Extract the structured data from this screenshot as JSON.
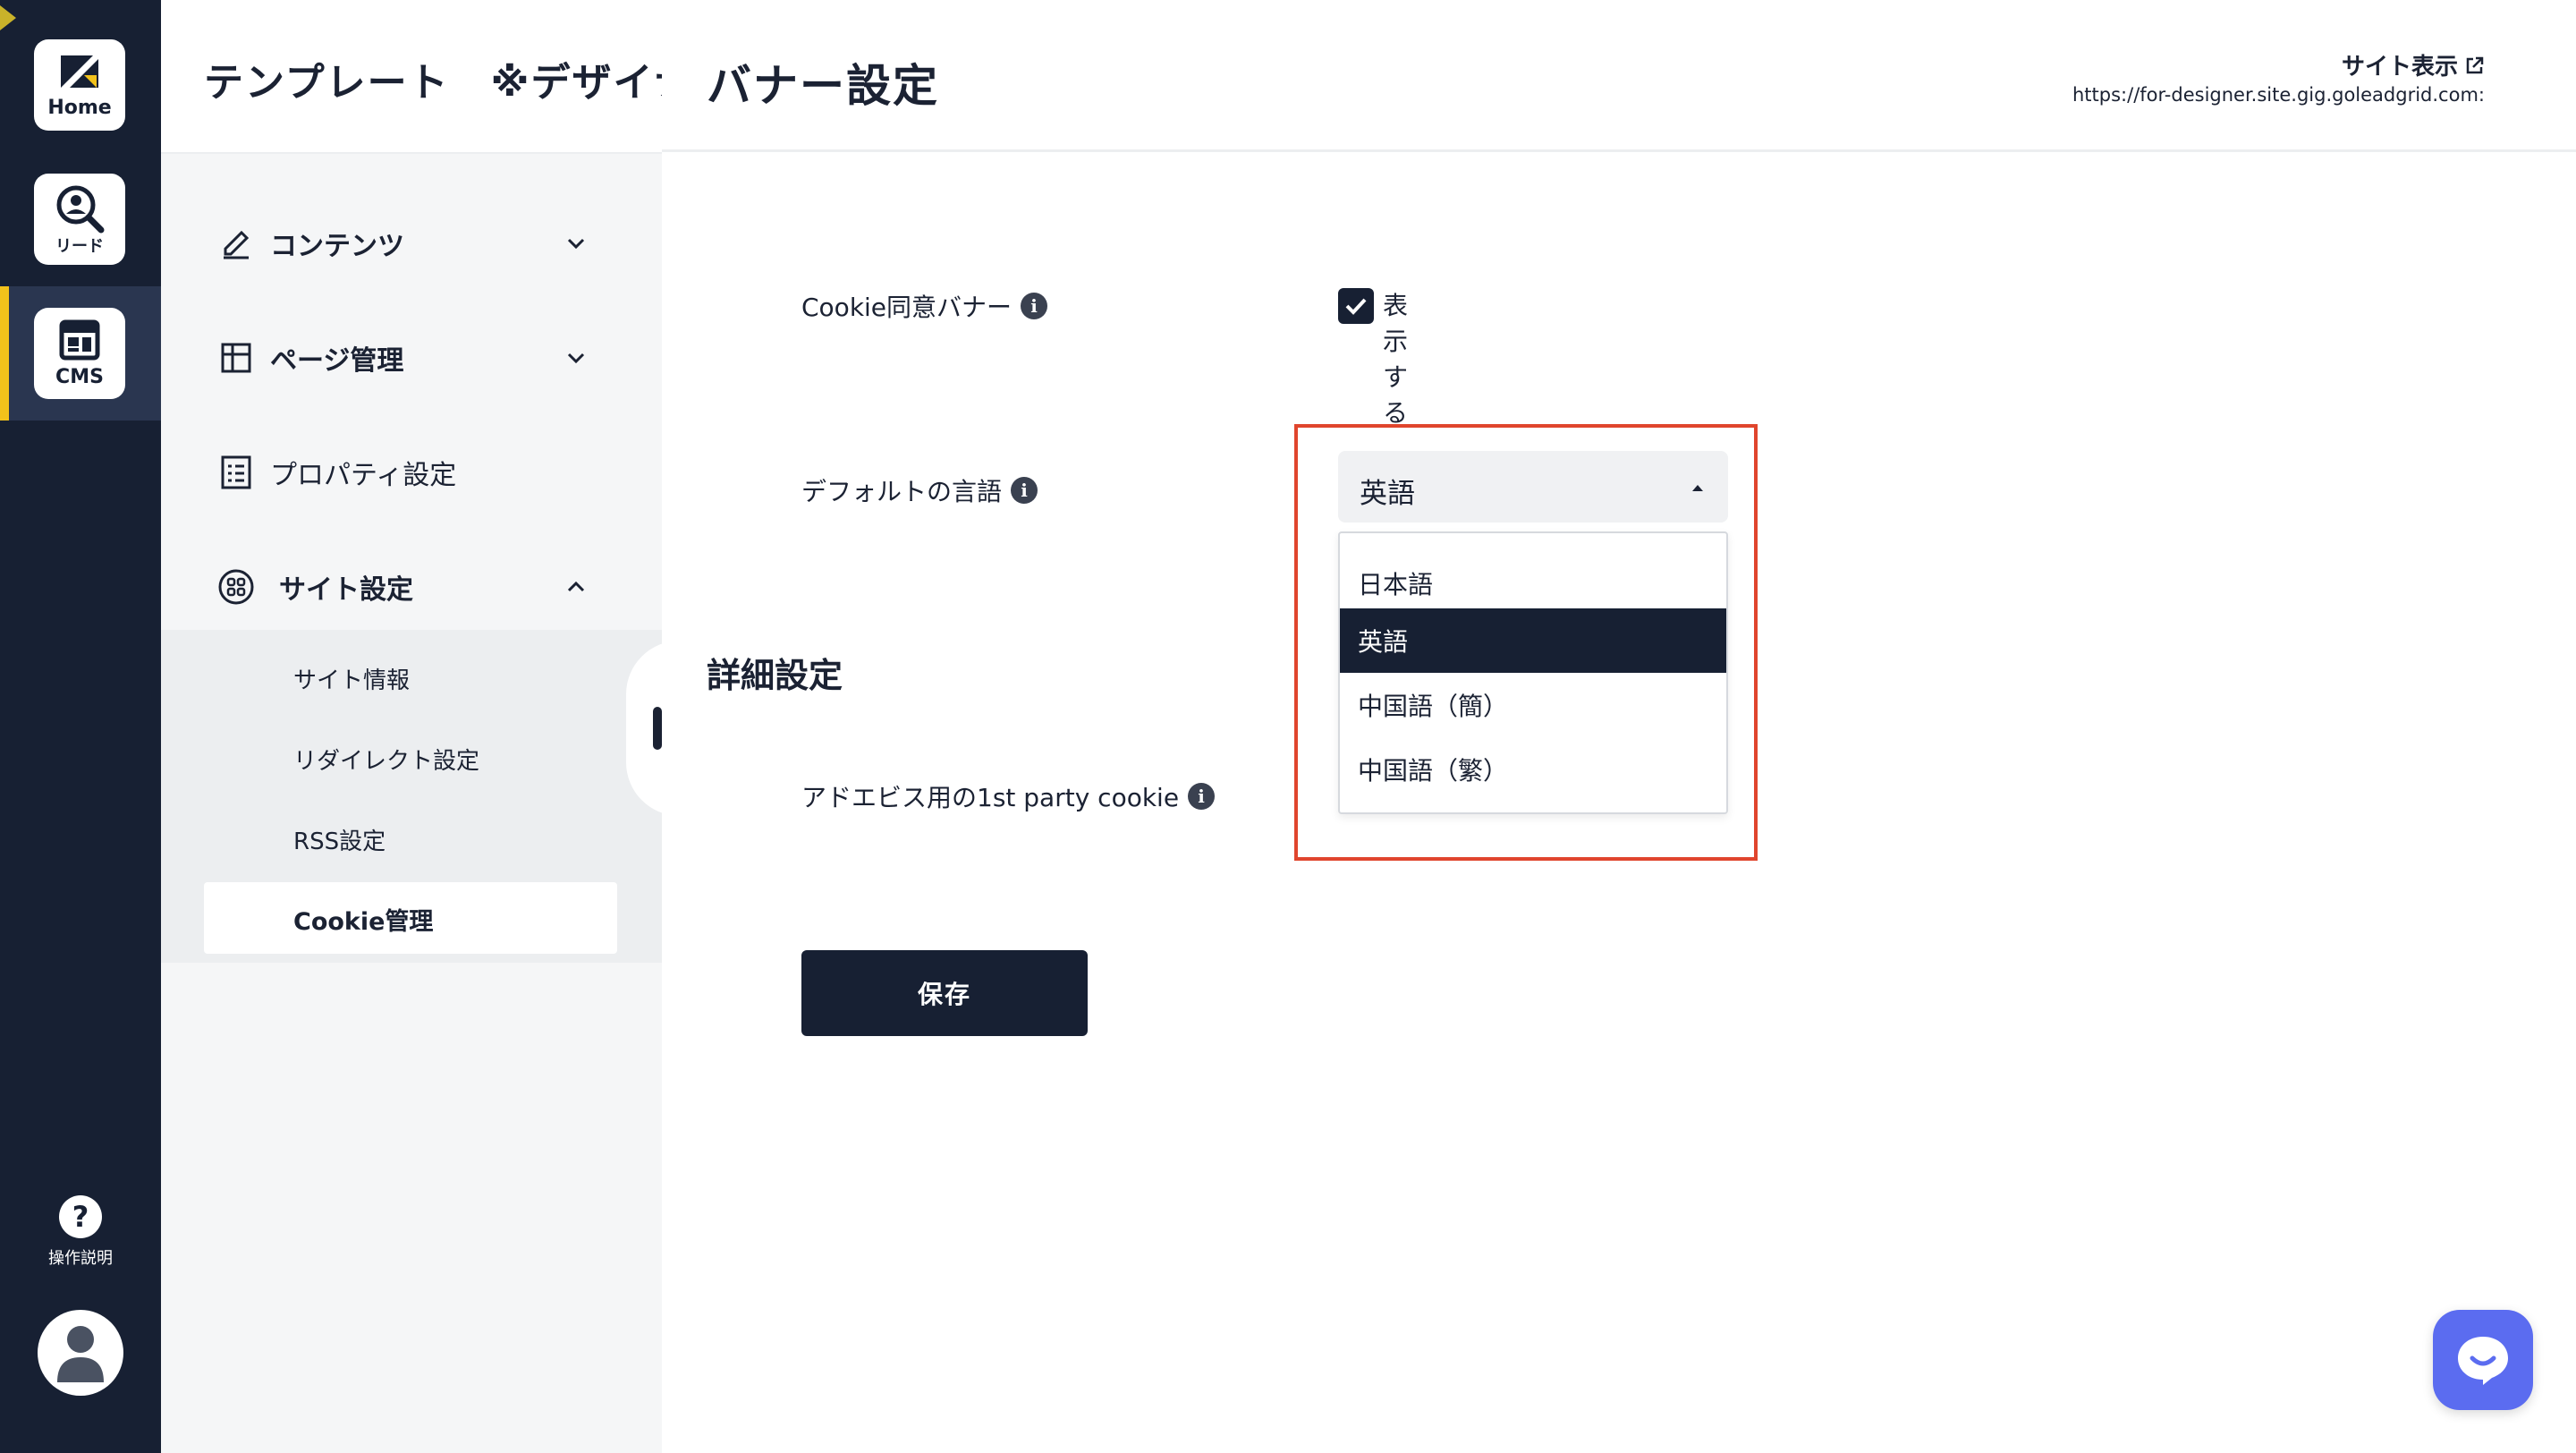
{
  "rail": {
    "home_label": "Home",
    "lead_label": "リード",
    "cms_label": "CMS",
    "help_label": "操作説明",
    "accent_color": "#f2c21b"
  },
  "sidebar": {
    "title": "テンプレート　※デザイナー",
    "items": [
      {
        "label": "コンテンツ",
        "icon": "pencil-icon"
      },
      {
        "label": "ページ管理",
        "icon": "layout-icon"
      },
      {
        "label": "プロパティ設定",
        "icon": "list-icon"
      },
      {
        "label": "サイト設定",
        "icon": "grid-circle-icon"
      }
    ],
    "sub_items": [
      "サイト情報",
      "リダイレクト設定",
      "RSS設定",
      "Cookie管理"
    ]
  },
  "header": {
    "page_title": "バナー設定",
    "site_link": "サイト表示",
    "site_url": "https://for-designer.site.gig.goleadgrid.com:"
  },
  "form": {
    "cookie_banner_label": "Cookie同意バナー",
    "show_label": "表示する",
    "default_lang_label": "デフォルトの言語",
    "select_value": "英語",
    "options": [
      "日本語",
      "英語",
      "中国語（簡）",
      "中国語（繁）"
    ],
    "section_title": "詳細設定",
    "adebis_label": "アドエビス用の1st party cookie",
    "save_label": "保存"
  }
}
